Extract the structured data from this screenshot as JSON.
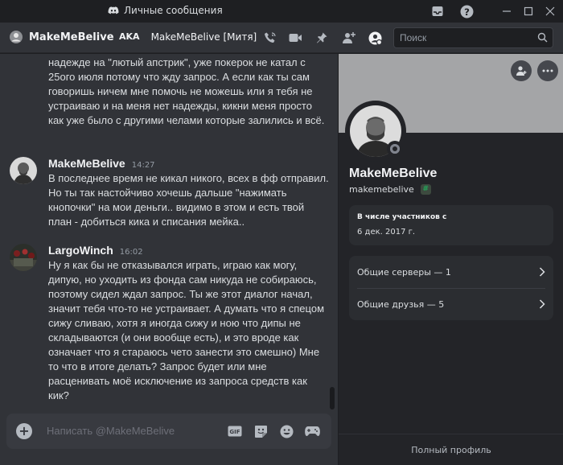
{
  "window": {
    "title": "Личные сообщения"
  },
  "header": {
    "username": "MakeMeBelive",
    "aka_label": "AKA",
    "aka_nick": "MakeMeBelive [Митя]",
    "search_placeholder": "Поиск"
  },
  "messages": {
    "continued_text": "надежде на \"лютый апстрик\", уже покерок не катал с 25ого июля потому что жду запрос. А если как ты сам говоришь ничем мне помочь не можешь или я тебя не устраиваю и на меня нет надежды, кикни меня просто как уже было с другими челами которые залились и всё.",
    "items": [
      {
        "author": "MakeMeBelive",
        "time": "14:27",
        "text": "В последнее время не кикал никого, всех в фф отправил. Но ты так настойчиво хочешь дальше \"нажимать кнопочки\" на мои деньги.. видимо в этом и есть твой план - добиться кика и списания мейка.."
      },
      {
        "author": "LargoWinch",
        "time": "16:02",
        "text": "Ну я как бы не отказывался играть, играю как могу, дипую, но уходить из фонда сам никуда не собираюсь, поэтому сидел ждал запрос. Ты же этот диалог начал, значит тебя что-то не устраивает. А думать что я спецом сижу сливаю, хотя я иногда сижу и ною что дипы не складываются (и они вообще есть), и это вроде как означает что я стараюсь чето занести это смешно) Мне то что в итоге делать? Запрос будет или мне расценивать моё исключение из запроса средств как кик?"
      }
    ]
  },
  "composer": {
    "placeholder": "Написать @MakeMeBelive",
    "gif_label": "GIF"
  },
  "profile": {
    "display_name": "MakeMeBelive",
    "handle": "makemebelive",
    "member_since_label": "В числе участников с",
    "member_since_value": "6 дек. 2017 г.",
    "mutual_servers": "Общие серверы — 1",
    "mutual_friends": "Общие друзья — 5",
    "full_profile": "Полный профиль"
  },
  "colors": {
    "background": "#313338",
    "panel": "#232428",
    "banner": "#a4a5a7",
    "text": "#dbdee1"
  }
}
